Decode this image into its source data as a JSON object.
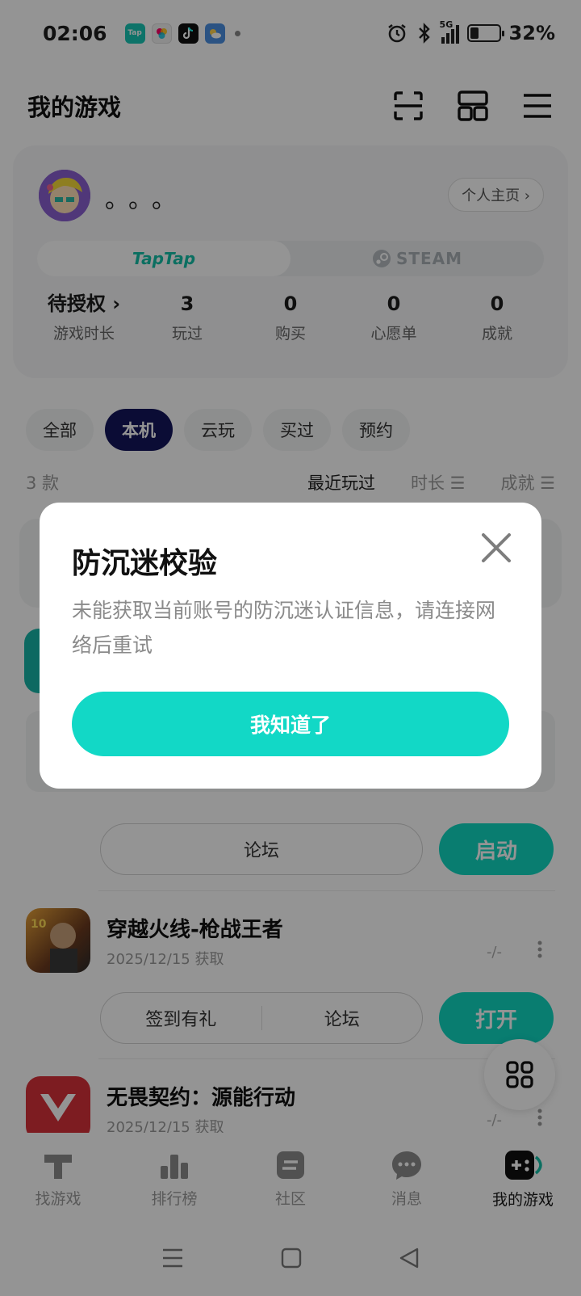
{
  "status_bar": {
    "time": "02:06",
    "network": "5G",
    "battery": "32%",
    "battery_level": 0.32,
    "app_icons": [
      "taptap-icon",
      "photos-app-icon",
      "tiktok-icon",
      "weather-icon"
    ]
  },
  "header": {
    "title": "我的游戏",
    "icons": [
      "scan-icon",
      "grid-layout-icon",
      "menu-icon"
    ]
  },
  "profile": {
    "username": "。。。",
    "homepage_button": "个人主页 ›",
    "platforms": [
      "TapTap",
      "STEAM"
    ],
    "stats": [
      {
        "value": "待授权 ›",
        "label": "游戏时长"
      },
      {
        "value": "3",
        "label": "玩过"
      },
      {
        "value": "0",
        "label": "购买"
      },
      {
        "value": "0",
        "label": "心愿单"
      },
      {
        "value": "0",
        "label": "成就"
      }
    ]
  },
  "filters": {
    "chips": [
      "全部",
      "本机",
      "云玩",
      "买过",
      "预约"
    ],
    "active": "本机",
    "count": "3 款",
    "sort": [
      "最近玩过",
      "时长 ☰",
      "成就 ☰"
    ]
  },
  "games": [
    {
      "buttons": [
        "论坛"
      ],
      "primary": "启动"
    },
    {
      "title": "穿越火线-枪战王者",
      "subtitle": "2025/12/15 获取",
      "playtime": "-/-",
      "buttons": [
        "签到有礼",
        "论坛"
      ],
      "primary": "打开"
    },
    {
      "title": "无畏契约：源能行动",
      "subtitle": "2025/12/15 获取",
      "playtime": "-/-"
    }
  ],
  "bottom_nav": [
    {
      "label": "找游戏",
      "icon": "find-games-icon"
    },
    {
      "label": "排行榜",
      "icon": "ranking-icon"
    },
    {
      "label": "社区",
      "icon": "community-icon"
    },
    {
      "label": "消息",
      "icon": "message-icon"
    },
    {
      "label": "我的游戏",
      "icon": "my-games-icon"
    }
  ],
  "dialog": {
    "title": "防沉迷校验",
    "message": "未能获取当前账号的防沉迷认证信息，请连接网络后重试",
    "confirm": "我知道了"
  },
  "colors": {
    "accent": "#12d8c6",
    "active_chip": "#14155c",
    "overlay": "rgba(0,0,0,0.42)"
  }
}
